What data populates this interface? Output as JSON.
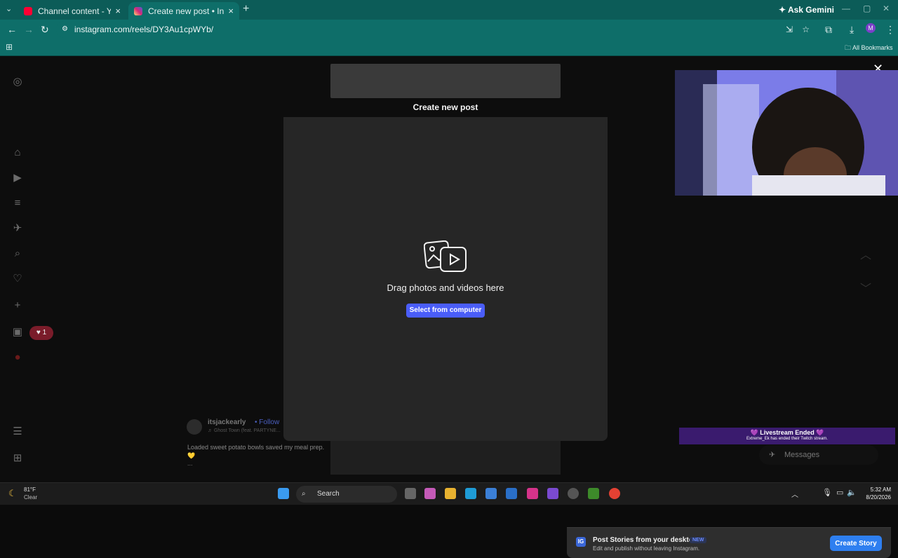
{
  "browser": {
    "tabs": [
      {
        "title": "Channel content - YouTube Stu",
        "favicon_color": "#ff0033"
      },
      {
        "title": "Create new post • Instagram",
        "favicon_color": "#d62976"
      }
    ],
    "ask_gemini": "Ask Gemini",
    "url": "instagram.com/reels/DY3Au1cpWYb/",
    "bookmarks_label": "All Bookmarks"
  },
  "instagram": {
    "heart_badge": "1",
    "modal": {
      "title": "Create new post",
      "drag_text": "Drag photos and videos here",
      "select_button": "Select from computer",
      "story_title": "Post Stories from your desktop",
      "story_badge": "NEW",
      "story_subtitle": "Edit and publish without leaving Instagram.",
      "story_button": "Create Story"
    },
    "reel": {
      "username": "itsjackearly",
      "follow": "• Follow",
      "music": "♬  Ghost Town (feat. PARTYNE...",
      "caption": "Loaded sweet potato bowls saved my meal prep. 💛",
      "more": "..."
    },
    "messages_label": "Messages"
  },
  "overlay": {
    "live_title": "💜 Livestream Ended 💜",
    "live_subtitle": "Extreme_Ek has ended their Twitch stream."
  },
  "taskbar": {
    "temp": "81°F",
    "condition": "Clear",
    "search_placeholder": "Search",
    "time": "5:32 AM",
    "date": "8/20/2026"
  }
}
